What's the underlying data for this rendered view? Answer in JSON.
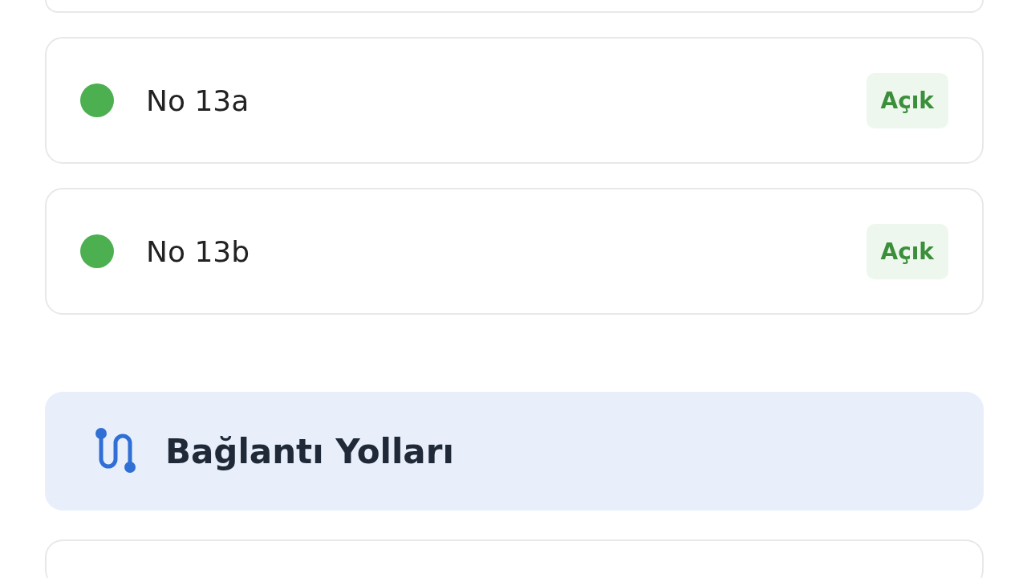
{
  "items": [
    {
      "name": "No 13a",
      "status": "Açık",
      "color": "#4caf50"
    },
    {
      "name": "No 13b",
      "status": "Açık",
      "color": "#4caf50"
    }
  ],
  "section": {
    "title": "Bağlantı Yolları"
  }
}
